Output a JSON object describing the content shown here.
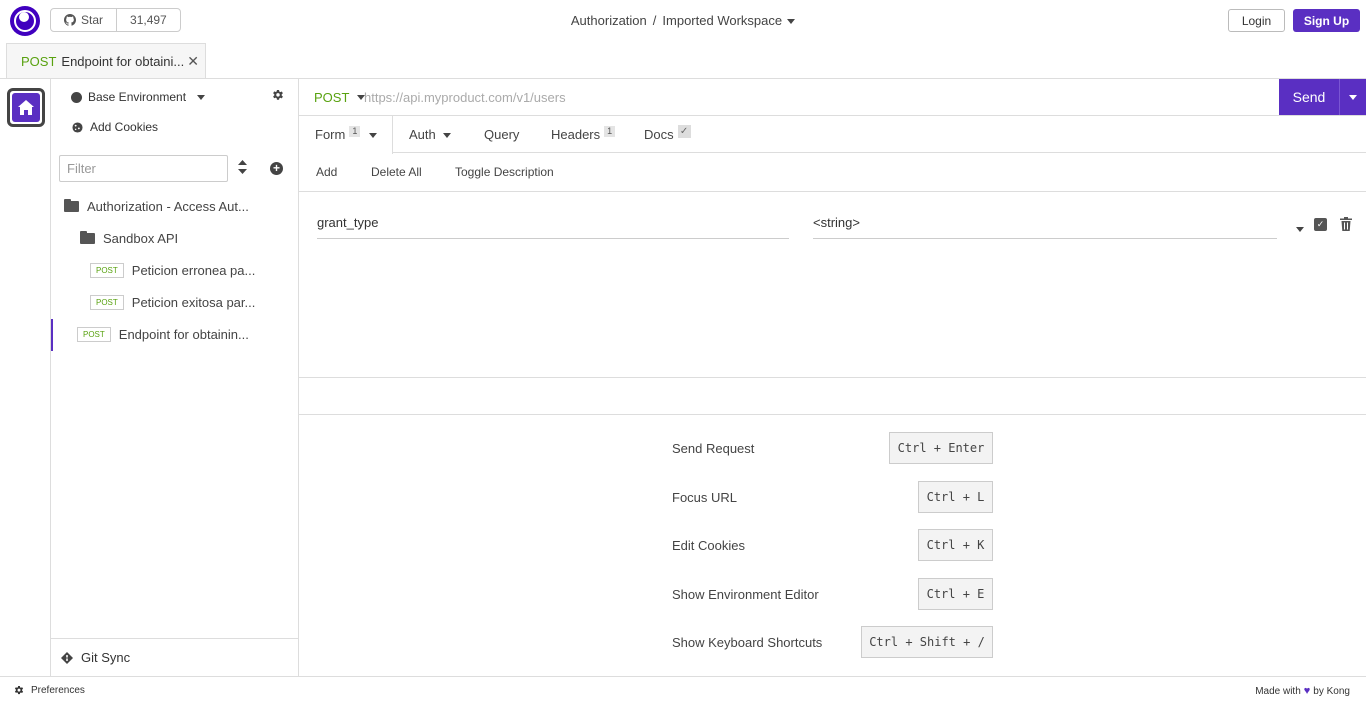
{
  "header": {
    "github_star_label": "Star",
    "github_star_count": "31,497",
    "breadcrumb_root": "Authorization",
    "breadcrumb_sep": "/",
    "breadcrumb_workspace": "Imported Workspace",
    "login_label": "Login",
    "signup_label": "Sign Up"
  },
  "tabs": [
    {
      "method": "POST",
      "title": "Endpoint for obtaini...",
      "close": "✕"
    }
  ],
  "sidebar": {
    "environment": "Base Environment",
    "add_cookies": "Add Cookies",
    "filter_placeholder": "Filter",
    "tree": [
      {
        "type": "folder",
        "label": "Authorization - Access Aut..."
      },
      {
        "type": "folder",
        "label": "Sandbox API"
      },
      {
        "type": "request",
        "method": "POST",
        "label": "Peticion erronea pa..."
      },
      {
        "type": "request",
        "method": "POST",
        "label": "Peticion exitosa par..."
      },
      {
        "type": "request",
        "method": "POST",
        "label": "Endpoint for obtainin..."
      }
    ],
    "git_sync": "Git Sync"
  },
  "request": {
    "method": "POST",
    "url_placeholder": "https://api.myproduct.com/v1/users",
    "send_label": "Send",
    "tabs": {
      "form": "Form",
      "form_count": "1",
      "auth": "Auth",
      "query": "Query",
      "headers": "Headers",
      "headers_count": "1",
      "docs": "Docs",
      "docs_check": "✓"
    },
    "actions": {
      "add": "Add",
      "delete_all": "Delete All",
      "toggle_description": "Toggle Description"
    },
    "params": [
      {
        "name": "grant_type",
        "value": "<string>"
      }
    ]
  },
  "shortcuts": [
    {
      "label": "Send Request",
      "keys": "Ctrl + Enter"
    },
    {
      "label": "Focus URL",
      "keys": "Ctrl + L"
    },
    {
      "label": "Edit Cookies",
      "keys": "Ctrl + K"
    },
    {
      "label": "Show Environment Editor",
      "keys": "Ctrl + E"
    },
    {
      "label": "Show Keyboard Shortcuts",
      "keys": "Ctrl + Shift + /"
    }
  ],
  "footer": {
    "preferences": "Preferences",
    "made_with": "Made with",
    "by_kong": "by Kong"
  },
  "colors": {
    "accent": "#5a2fc2",
    "method_post": "#59a210"
  }
}
